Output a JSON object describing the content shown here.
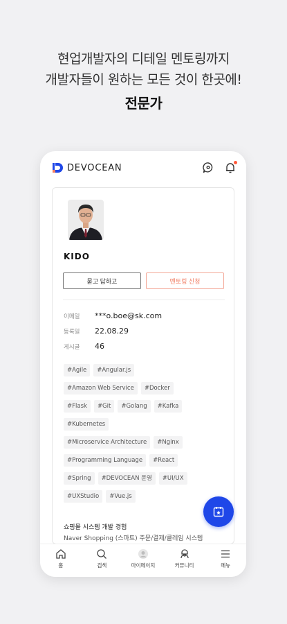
{
  "headline": {
    "line1": "현업개발자의 디테일 멘토링까지",
    "line2": "개발자들이 원하는 모든 것이 한곳에!",
    "line3": "전문가"
  },
  "app": {
    "brand": "DEVOCEAN",
    "brand_color": "#1f47e8",
    "accent_color": "#f07c62"
  },
  "profile": {
    "name": "KIDO",
    "ask_button": "묻고 답하고",
    "mentor_button": "멘토링 신청",
    "info": [
      {
        "key": "이메일",
        "value": "***o.boe@sk.com"
      },
      {
        "key": "등록일",
        "value": "22.08.29"
      },
      {
        "key": "게시글",
        "value": "46"
      }
    ],
    "tags": [
      [
        "#Agile",
        "#Angular.js"
      ],
      [
        "#Amazon Web Service",
        "#Docker"
      ],
      [
        "#Flask",
        "#Git",
        "#Golang",
        "#Kafka"
      ],
      [
        "#Kubernetes"
      ],
      [
        "#Microservice Architecture",
        "#Nginx"
      ],
      [
        "#Programming Language",
        "#React"
      ],
      [
        "#Spring",
        "#DEVOCEAN 운영",
        "#UI/UX"
      ],
      [
        "#UXStudio",
        "#Vue.js"
      ]
    ],
    "career_title": "쇼핑몰 시스템 개발 경험",
    "career_detail": "Naver Shopping (스마트) 주문/결제/클레임 시스템"
  },
  "tabbar": [
    {
      "label": "홈",
      "icon": "home-icon"
    },
    {
      "label": "검색",
      "icon": "search-icon"
    },
    {
      "label": "마이페이지",
      "icon": "mypage-icon"
    },
    {
      "label": "커뮤니티",
      "icon": "community-icon"
    },
    {
      "label": "메뉴",
      "icon": "menu-icon"
    }
  ]
}
